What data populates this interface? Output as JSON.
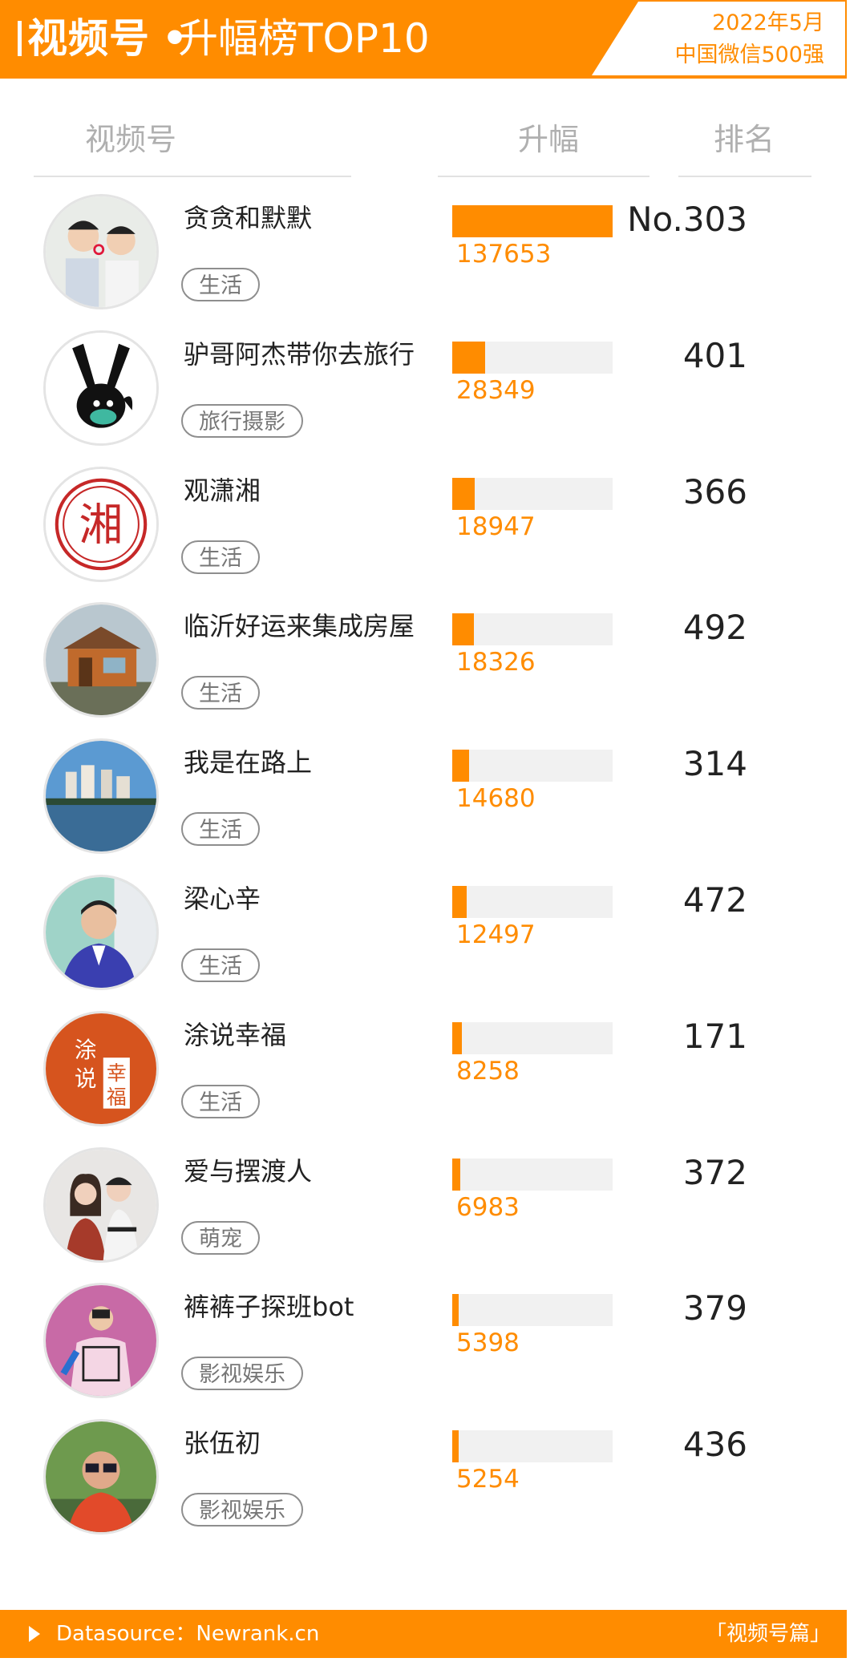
{
  "header": {
    "title_main": "视频号",
    "title_dot": "•",
    "title_sub": "升幅榜TOP10",
    "date_line1": "2022年5月",
    "date_line2": "中国微信500强",
    "accent_color": "#ff8c00"
  },
  "columns": {
    "account": "视频号",
    "gain": "升幅",
    "rank": "排名"
  },
  "chart_data": {
    "type": "bar",
    "xlabel": "",
    "ylabel": "",
    "ylim": [
      0,
      137653
    ],
    "rows": [
      {
        "name": "贪贪和默默",
        "tag": "生活",
        "gain": 137653,
        "gain_label": "137653",
        "rank": "No.303",
        "avatar": "couple-avatar"
      },
      {
        "name": "驴哥阿杰带你去旅行",
        "tag": "旅行摄影",
        "gain": 28349,
        "gain_label": "28349",
        "rank": "401",
        "avatar": "donkey-avatar"
      },
      {
        "name": "观潇湘",
        "tag": "生活",
        "gain": 18947,
        "gain_label": "18947",
        "rank": "366",
        "avatar": "xiang-seal-avatar"
      },
      {
        "name": "临沂好运来集成房屋",
        "tag": "生活",
        "gain": 18326,
        "gain_label": "18326",
        "rank": "492",
        "avatar": "cabin-avatar"
      },
      {
        "name": "我是在路上",
        "tag": "生活",
        "gain": 14680,
        "gain_label": "14680",
        "rank": "314",
        "avatar": "city-lake-avatar"
      },
      {
        "name": "梁心辛",
        "tag": "生活",
        "gain": 12497,
        "gain_label": "12497",
        "rank": "472",
        "avatar": "man-suit-avatar"
      },
      {
        "name": "涂说幸福",
        "tag": "生活",
        "gain": 8258,
        "gain_label": "8258",
        "rank": "171",
        "avatar": "calligraphy-avatar"
      },
      {
        "name": "爱与摆渡人",
        "tag": "萌宠",
        "gain": 6983,
        "gain_label": "6983",
        "rank": "372",
        "avatar": "two-people-avatar"
      },
      {
        "name": "裤裤子探班bot",
        "tag": "影视娱乐",
        "gain": 5398,
        "gain_label": "5398",
        "rank": "379",
        "avatar": "pink-shirt-avatar"
      },
      {
        "name": "张伍初",
        "tag": "影视娱乐",
        "gain": 5254,
        "gain_label": "5254",
        "rank": "436",
        "avatar": "man-glasses-avatar"
      }
    ]
  },
  "footer": {
    "source": "Datasource：Newrank.cn",
    "tag": "「视频号篇」"
  }
}
